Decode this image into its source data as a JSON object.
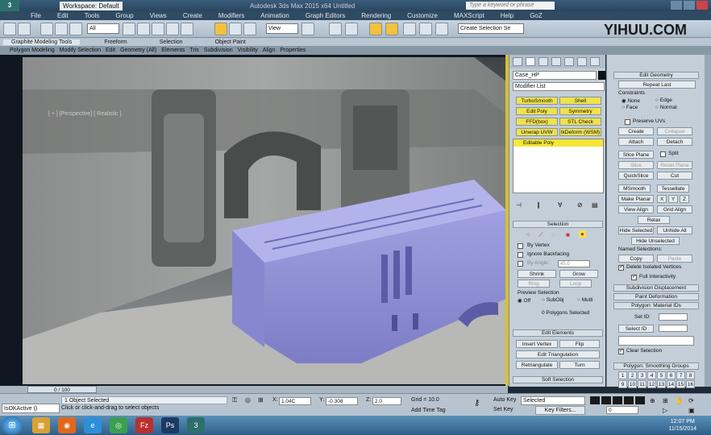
{
  "titlebar": {
    "logo": "3",
    "workspace": "Workspace: Default",
    "title": "Autodesk 3ds Max  2015 x64      Untitled",
    "search_placeholder": "Type a keyword or phrase"
  },
  "menu": [
    "File",
    "Edit",
    "Tools",
    "Group",
    "Views",
    "Create",
    "Modifiers",
    "Animation",
    "Graph Editors",
    "Rendering",
    "Customize",
    "MAXScript",
    "Help",
    "GoZ"
  ],
  "toolbar": {
    "filter": "All",
    "view": "View",
    "selection_set": "Create Selection Se"
  },
  "watermark": "YIHUU.COM",
  "ribbon": {
    "tabs": [
      "Graphite Modeling Tools",
      "Freeform",
      "Selection",
      "Object Paint"
    ],
    "subtabs": [
      "Polygon Modeling",
      "Modify Selection",
      "Edit",
      "Geometry (All)",
      "Elements",
      "Tris",
      "Subdivision",
      "Visibility",
      "Align",
      "Properties"
    ]
  },
  "viewport": {
    "label": "[ + ] [Perspective] [ Realistic ]"
  },
  "command_panel": {
    "object_name": "Case_HP",
    "modifier_list": "Modifier List",
    "mod_buttons": [
      "TurboSmooth",
      "Shell",
      "Edit Poly",
      "Symmetry",
      "FFD(box)",
      "STL Check",
      "Unwrap UVW",
      "tkDeform (WSM)"
    ],
    "stack_item": "Editable Poly",
    "selection_header": "Selection",
    "by_vertex": "By Vertex",
    "ignore_backfacing": "Ignore Backfacing",
    "by_angle": "By Angle:",
    "angle_value": "45.0",
    "shrink": "Shrink",
    "grow": "Grow",
    "ring": "Ring",
    "loop": "Loop",
    "preview_selection": "Preview Selection",
    "off": "Off",
    "subobj": "SubObj",
    "multi": "Multi",
    "status": "0 Polygons Selected",
    "edit_elements": "Edit Elements",
    "insert_vertex": "Insert Vertex",
    "flip": "Flip",
    "edit_triangulation": "Edit Triangulation",
    "retriangulate": "Retriangulate",
    "turn": "Turn",
    "soft_selection": "Soft Selection"
  },
  "edit_geometry": {
    "header": "Edit Geometry",
    "repeat_last": "Repeat Last",
    "constraints": "Constraints",
    "none": "None",
    "edge": "Edge",
    "face": "Face",
    "normal": "Normal",
    "preserve_uvs": "Preserve UVs",
    "create": "Create",
    "collapse": "Collapse",
    "attach": "Attach",
    "detach": "Detach",
    "slice_plane": "Slice Plane",
    "split": "Split",
    "slice": "Slice",
    "reset_plane": "Reset Plane",
    "quickslice": "QuickSlice",
    "cut": "Cut",
    "msmooth": "MSmooth",
    "tessellate": "Tessellate",
    "make_planar": "Make Planar",
    "x": "X",
    "y": "Y",
    "z": "Z",
    "view_align": "View Align",
    "grid_align": "Grid Align",
    "relax": "Relax",
    "hide_selected": "Hide Selected",
    "unhide_all": "Unhide All",
    "hide_unselected": "Hide Unselected",
    "named_selections": "Named Selections:",
    "copy": "Copy",
    "paste": "Paste",
    "delete_isolated": "Delete Isolated Vertices",
    "full_interactivity": "Full Interactivity",
    "subdivision_displacement": "Subdivision Displacement",
    "paint_deformation": "Paint Deformation",
    "polygon_material_ids": "Polygon: Material IDs",
    "set_id": "Set ID:",
    "select_id": "Select ID",
    "clear_selection": "Clear Selection",
    "smoothing_groups": "Polygon: Smoothing Groups",
    "sg_numbers": [
      "1",
      "2",
      "3",
      "4",
      "5",
      "6",
      "7",
      "8",
      "9",
      "10",
      "11",
      "12",
      "13",
      "14",
      "15",
      "16"
    ]
  },
  "timeline": {
    "frame": "0 / 100"
  },
  "status": {
    "maxscript": "IsOKActive ()",
    "objects_selected": "1 Object Selected",
    "prompt": "Click or click-and-drag to select objects",
    "x_label": "X:",
    "x_value": "1.04C",
    "y_label": "Y:",
    "y_value": "-0.308",
    "z_label": "Z:",
    "z_value": "2.0",
    "grid": "Grid = 10.0",
    "add_time_tag": "Add Time Tag",
    "auto_key": "Auto Key",
    "set_key": "Set Key",
    "selected": "Selected",
    "key_filters": "Key Filters...",
    "frame_value": "0"
  },
  "taskbar": {
    "time": "12:07 PM",
    "date": "11/15/2014",
    "apps": [
      {
        "icon": "folder-icon",
        "glyph": "▦",
        "color": "#d9a233"
      },
      {
        "icon": "firefox-icon",
        "glyph": "◉",
        "color": "#e3671b"
      },
      {
        "icon": "ie-icon",
        "glyph": "e",
        "color": "#2d8fd8"
      },
      {
        "icon": "chrome-icon",
        "glyph": "◎",
        "color": "#3aa050"
      },
      {
        "icon": "filezilla-icon",
        "glyph": "Fz",
        "color": "#b8312f"
      },
      {
        "icon": "photoshop-icon",
        "glyph": "Ps",
        "color": "#1b3a64"
      },
      {
        "icon": "3dsmax-icon",
        "glyph": "3",
        "color": "#2d6f6c"
      }
    ]
  }
}
